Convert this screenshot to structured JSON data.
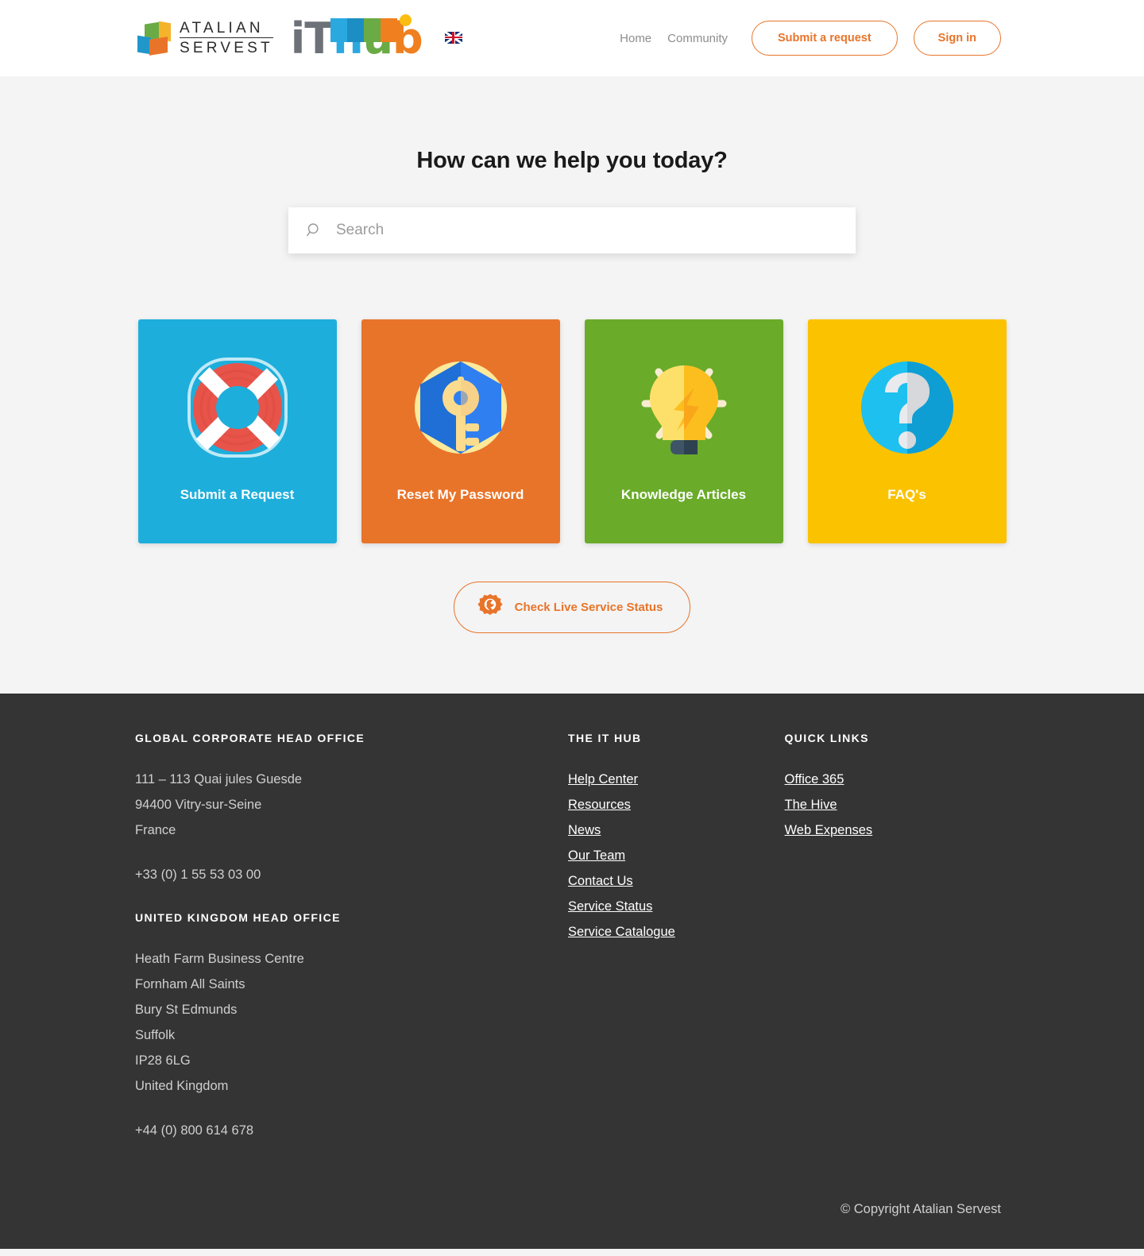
{
  "header": {
    "brand_logo_text_line1": "ATALIAN",
    "brand_logo_text_line2": "SERVEST",
    "product_logo_i": "i",
    "product_logo_t": "T",
    "product_logo_h": "h",
    "product_logo_u": "u",
    "product_logo_b": "b",
    "locale_flag": "uk-flag-icon",
    "nav": [
      {
        "label": "Home",
        "name": "nav-home"
      },
      {
        "label": "Community",
        "name": "nav-community"
      }
    ],
    "submit_request_label": "Submit a request",
    "sign_in_label": "Sign in",
    "accent_color": "#e8742a"
  },
  "hero": {
    "title": "How can we help you today?",
    "search_placeholder": "Search",
    "search_value": "",
    "search_icon": "magnifier-icon"
  },
  "cards": [
    {
      "label": "Submit a Request",
      "bg": "#1eaedb",
      "icon": "lifebuoy-icon",
      "name": "card-submit-a-request"
    },
    {
      "label": "Reset My Password",
      "bg": "#e8742a",
      "icon": "shield-key-icon",
      "name": "card-reset-my-password"
    },
    {
      "label": "Knowledge Articles",
      "bg": "#6aab2a",
      "icon": "lightbulb-icon",
      "name": "card-knowledge-articles"
    },
    {
      "label": "FAQ's",
      "bg": "#fbc200",
      "icon": "question-mark-icon",
      "name": "card-faqs"
    }
  ],
  "service_status": {
    "label": "Check Live Service Status",
    "icon": "gear-wrench-icon",
    "color": "#e8742a"
  },
  "footer": {
    "global_office": {
      "heading": "GLOBAL CORPORATE HEAD OFFICE",
      "lines": [
        "111 – 113 Quai jules Guesde",
        "94400 Vitry-sur-Seine",
        "France"
      ],
      "phone": "+33 (0) 1 55 53 03 00"
    },
    "uk_office": {
      "heading": "UNITED KINGDOM HEAD OFFICE",
      "lines": [
        "Heath Farm Business Centre",
        "Fornham All Saints",
        "Bury St Edmunds",
        "Suffolk",
        "IP28 6LG",
        "United Kingdom"
      ],
      "phone": "+44 (0) 800 614 678"
    },
    "it_hub": {
      "heading": "THE IT HUB",
      "links": [
        "Help Center",
        "Resources",
        "News",
        "Our Team",
        "Contact Us",
        "Service Status",
        "Service Catalogue"
      ]
    },
    "quick_links": {
      "heading": "QUICK LINKS",
      "links": [
        "Office 365",
        "The Hive",
        "Web Expenses"
      ]
    },
    "copyright": "© Copyright Atalian Servest",
    "background": "#343434"
  }
}
